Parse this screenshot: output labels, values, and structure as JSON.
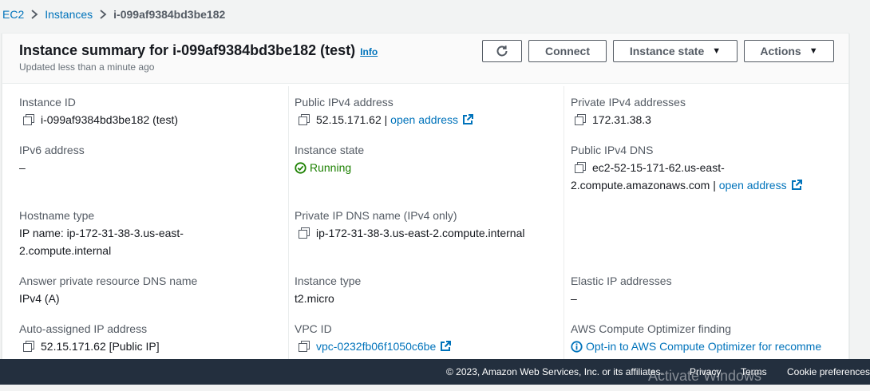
{
  "breadcrumb": {
    "root": "EC2",
    "parent": "Instances",
    "current": "i-099af9384bd3be182"
  },
  "header": {
    "title": "Instance summary for i-099af9384bd3be182 (test)",
    "info": "Info",
    "updated": "Updated less than a minute ago",
    "buttons": {
      "connect": "Connect",
      "instance_state": "Instance state",
      "actions": "Actions"
    }
  },
  "details": {
    "instance_id": {
      "label": "Instance ID",
      "value": "i-099af9384bd3be182 (test)"
    },
    "ipv6": {
      "label": "IPv6 address",
      "value": "–"
    },
    "hostname_type": {
      "label": "Hostname type",
      "value_line1": "IP name: ip-172-31-38-3.us-east-",
      "value_line2": "2.compute.internal"
    },
    "answer_dns": {
      "label": "Answer private resource DNS name",
      "value": "IPv4 (A)"
    },
    "auto_ip": {
      "label": "Auto-assigned IP address",
      "value": "52.15.171.62 [Public IP]"
    },
    "public_ipv4": {
      "label": "Public IPv4 address",
      "value": "52.15.171.62",
      "separator": "|",
      "link": "open address"
    },
    "instance_state": {
      "label": "Instance state",
      "value": "Running"
    },
    "private_ip_dns": {
      "label": "Private IP DNS name (IPv4 only)",
      "value": "ip-172-31-38-3.us-east-2.compute.internal"
    },
    "instance_type": {
      "label": "Instance type",
      "value": "t2.micro"
    },
    "vpc_id": {
      "label": "VPC ID",
      "value": "vpc-0232fb06f1050c6be"
    },
    "private_ipv4": {
      "label": "Private IPv4 addresses",
      "value": "172.31.38.3"
    },
    "public_dns": {
      "label": "Public IPv4 DNS",
      "value_line1": "ec2-52-15-171-62.us-east-",
      "value_line2": "2.compute.amazonaws.com",
      "separator": "|",
      "link": "open address"
    },
    "elastic_ip": {
      "label": "Elastic IP addresses",
      "value": "–"
    },
    "optimizer": {
      "label": "AWS Compute Optimizer finding",
      "link": "Opt-in to AWS Compute Optimizer for recomme"
    }
  },
  "footer": {
    "copyright": "© 2023, Amazon Web Services, Inc. or its affiliates.",
    "privacy": "Privacy",
    "terms": "Terms",
    "cookies": "Cookie preferences",
    "watermark": "Activate Windows"
  },
  "colors": {
    "link": "#0073bb",
    "running": "#1d8102",
    "footer_bg": "#232f3e"
  }
}
